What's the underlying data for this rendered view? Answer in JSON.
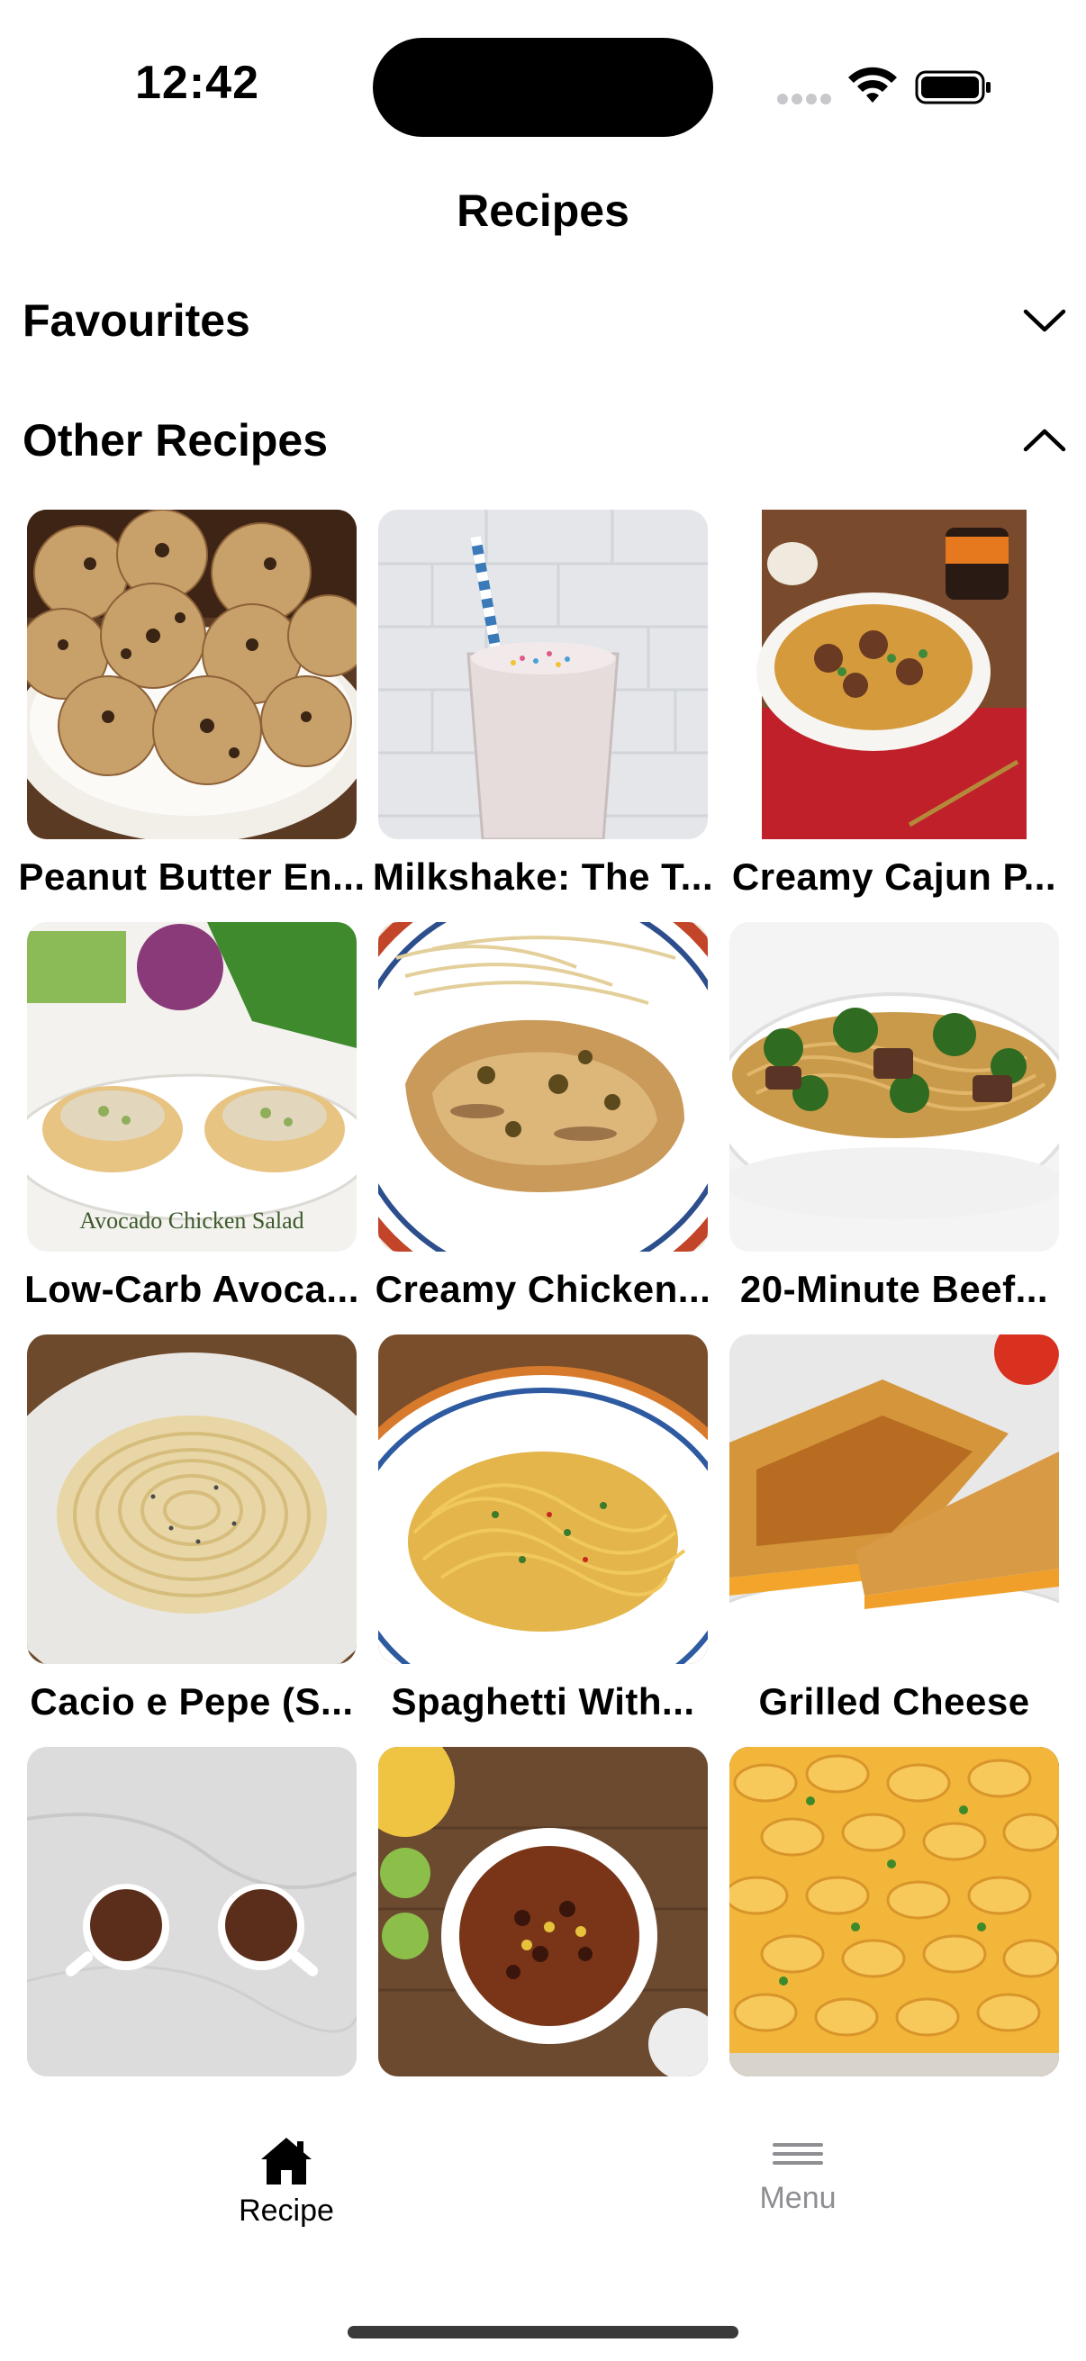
{
  "status_bar": {
    "time": "12:42"
  },
  "navigation": {
    "title": "Recipes"
  },
  "sections": {
    "favourites": {
      "title": "Favourites",
      "chevron": "chevron-down-icon"
    },
    "other": {
      "title": "Other Recipes",
      "chevron": "chevron-up-icon"
    }
  },
  "recipes": [
    {
      "title": "Peanut Butter En...",
      "image": "energy-balls"
    },
    {
      "title": "Milkshake: The T...",
      "image": "milkshake"
    },
    {
      "title": "Creamy Cajun P...",
      "image": "cajun-pasta"
    },
    {
      "title": "Low-Carb Avoca...",
      "image": "avocado-chicken-salad",
      "image_caption": "Avocado Chicken Salad"
    },
    {
      "title": "Creamy Chicken...",
      "image": "chicken-piccata"
    },
    {
      "title": "20-Minute Beef...",
      "image": "beef-noodles"
    },
    {
      "title": "Cacio e Pepe (S...",
      "image": "cacio-e-pepe"
    },
    {
      "title": "Spaghetti With...",
      "image": "spaghetti"
    },
    {
      "title": "Grilled Cheese",
      "image": "grilled-cheese"
    },
    {
      "title": "",
      "image": "chocolate-mugs"
    },
    {
      "title": "",
      "image": "chili-bowl"
    },
    {
      "title": "",
      "image": "mac-and-cheese"
    }
  ],
  "tab_bar": {
    "items": [
      {
        "label": "Recipe",
        "icon": "house-icon",
        "selected": true
      },
      {
        "label": "Menu",
        "icon": "menu-lines-icon",
        "selected": false
      }
    ]
  },
  "colors": {
    "accent": "#000000",
    "inactive": "#8e8e93"
  }
}
